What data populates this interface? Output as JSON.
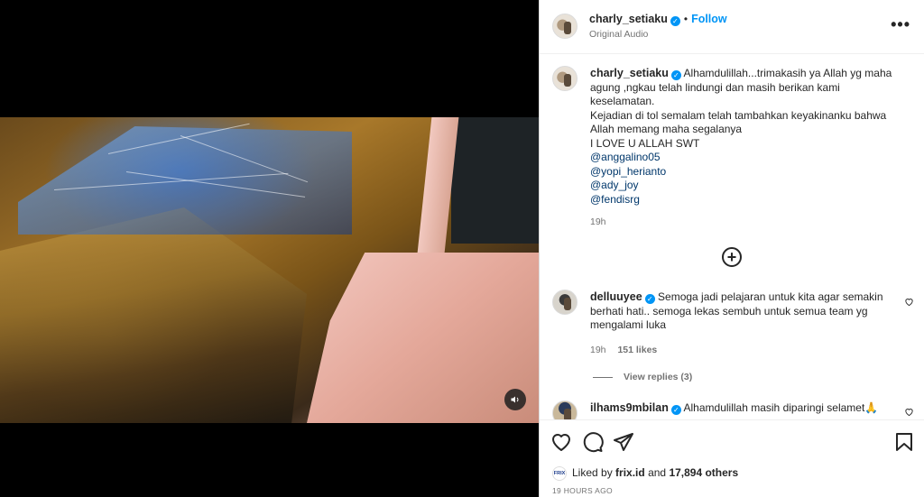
{
  "post": {
    "username": "charly_setiaku",
    "follow_label": "Follow",
    "separator": "•",
    "audio": "Original Audio",
    "more_label": "•••"
  },
  "caption": {
    "username": "charly_setiaku",
    "lines": [
      "Alhamdulillah...trimakasih ya Allah yg maha",
      "agung ,ngkau telah lindungi dan masih berikan kami",
      "keselamatan.",
      "Kejadian di tol semalam telah tambahkan keyakinanku bahwa",
      "Allah memang maha segalanya",
      "I LOVE U ALLAH SWT"
    ],
    "mentions": [
      "@anggalino05",
      "@yopi_herianto",
      "@ady_joy",
      "@fendisrg"
    ],
    "time": "19h"
  },
  "load_more_icon": "plus-circle-icon",
  "comments": [
    {
      "username": "delluuyee",
      "text_lines": [
        "Semoga jadi pelajaran untuk kita agar semakin",
        "berhati hati.. semoga lekas sembuh untuk semua team yg",
        "mengalami luka"
      ],
      "time": "19h",
      "likes": "151 likes",
      "view_replies": "View replies (3)"
    },
    {
      "username": "ilhams9mbilan",
      "text": "Alhamdulillah masih diparingi selamet🙏"
    }
  ],
  "actions": {
    "icons": [
      "heart-icon",
      "comment-icon",
      "share-icon",
      "bookmark-icon"
    ],
    "liked_prefix": "Liked by",
    "liked_user": "frix.id",
    "liked_and": "and",
    "liked_count": "17,894 others",
    "frix_logo_text": "FRIX",
    "time_ago": "19 HOURS AGO"
  },
  "verified_mark": "✓",
  "colors": {
    "accent": "#0095f6",
    "mention": "#00376b",
    "muted": "#737373"
  }
}
